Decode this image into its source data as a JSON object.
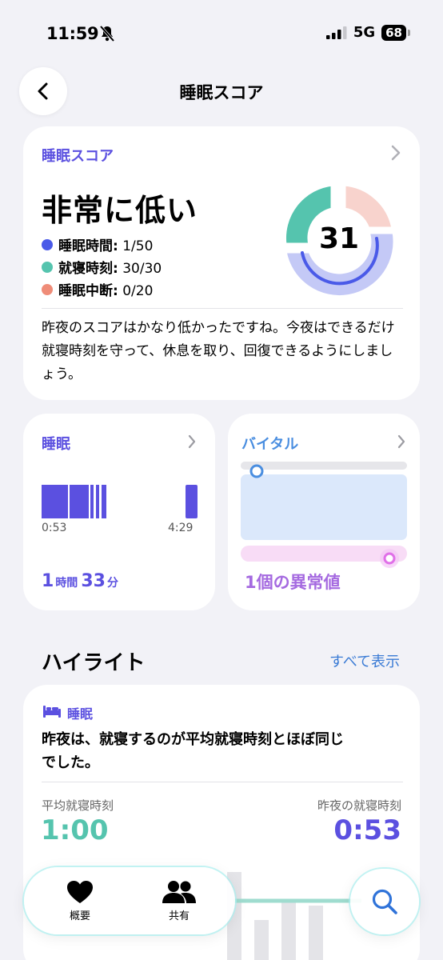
{
  "status": {
    "time": "11:59",
    "network": "5G",
    "battery": "68"
  },
  "nav": {
    "title": "睡眠スコア"
  },
  "score_card": {
    "label": "睡眠スコア",
    "rating": "非常に低い",
    "score": "31",
    "legend": [
      {
        "name": "睡眠時間:",
        "value": " 1/50",
        "color": "#4a5ae8"
      },
      {
        "name": "就寝時刻:",
        "value": " 30/30",
        "color": "#55c4ae"
      },
      {
        "name": "睡眠中断:",
        "value": " 0/20",
        "color": "#ef8c78"
      }
    ],
    "description": "昨夜のスコアはかなり低かったですね。今夜はできるだけ就寝時刻を守って、休息を取り、回復できるようにしましょう。"
  },
  "sleep_card": {
    "title": "睡眠",
    "start_time": "0:53",
    "end_time": "4:29",
    "hours": "1",
    "hours_unit": "時間",
    "minutes": "33",
    "minutes_unit": "分"
  },
  "vital_card": {
    "title": "バイタル",
    "summary": "1個の異常値"
  },
  "highlights": {
    "title": "ハイライト",
    "show_all": "すべて表示",
    "item": {
      "category": "睡眠",
      "headline": "昨夜は、就寝するのが平均就寝時刻とほぼ同じでした。",
      "avg_label": "平均就寝時刻",
      "avg_value": "1:00",
      "last_label": "昨夜の就寝時刻",
      "last_value": "0:53"
    }
  },
  "tabbar": {
    "tabs": [
      {
        "label": "概要"
      },
      {
        "label": "共有"
      }
    ]
  },
  "colors": {
    "accent": "#5b50e0",
    "teal": "#55c4ae",
    "coral": "#ef8c78",
    "blue": "#4a5ae8",
    "vital_blue": "#4a8ee0",
    "vital_pink": "#e070e8"
  }
}
